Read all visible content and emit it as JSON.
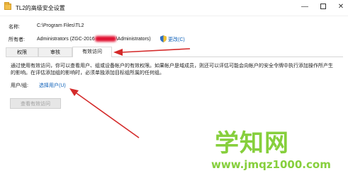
{
  "window": {
    "title": "TL2的高级安全设置"
  },
  "header": {
    "name_label": "名称:",
    "name_value": "C:\\Program Files\\TL2",
    "owner_label": "所有者:",
    "owner_value_prefix": "Administrators (ZGC-2016",
    "owner_value_suffix": "\\Administrators)",
    "change_link": "更改(C)"
  },
  "tabs": [
    {
      "label": "权限"
    },
    {
      "label": "审核"
    },
    {
      "label": "有效访问"
    }
  ],
  "effective_access": {
    "description_line1": "通过使用有效访问，你可以查看用户、组或设备帐户的有效权限。如果帐户是域成员，则还可以评估可能会向帐户的安全令牌中执行添加操作所产生",
    "description_line2": "的影响。在评估添加组的影响时，必须单独添加目标组所属的任何组。",
    "user_group_label": "用户/组:",
    "select_user_link": "选择用户(U)",
    "view_button": "查看有效访问"
  },
  "watermark": {
    "big_text": "学知网",
    "site_text": "www.jmqz1000.com"
  },
  "colors": {
    "arrow": "#d42a2a",
    "link": "#0b5fb8",
    "watermark": "#86cf3c"
  }
}
